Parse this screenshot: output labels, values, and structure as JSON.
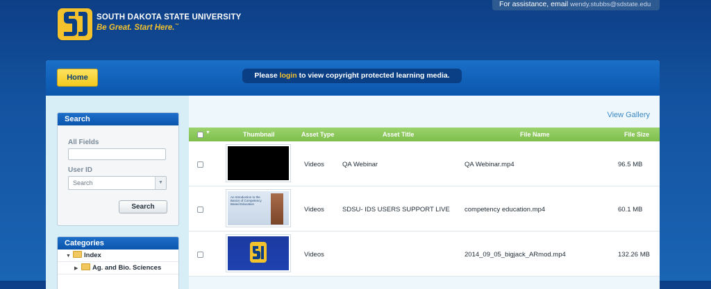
{
  "header": {
    "university_name": "SOUTH DAKOTA STATE UNIVERSITY",
    "tagline": "Be Great. Start Here.",
    "trademark": "™",
    "assistance_text": "For assistance, email",
    "assistance_email": "wendy.stubbs@sdstate.edu"
  },
  "topbar": {
    "home_label": "Home",
    "notice_before": "Please ",
    "notice_link": "login",
    "notice_after": " to view copyright protected learning media."
  },
  "search": {
    "title": "Search",
    "all_fields_label": "All Fields",
    "all_fields_value": "",
    "user_id_label": "User ID",
    "user_id_select_value": "Search",
    "button_label": "Search"
  },
  "categories": {
    "title": "Categories",
    "items": [
      {
        "label": "Index",
        "expanded": true
      },
      {
        "label": "Ag. and Bio. Sciences",
        "expanded": false
      }
    ]
  },
  "gallery": {
    "view_gallery_label": "View Gallery"
  },
  "table": {
    "headers": [
      "Thumbnail",
      "Asset Type",
      "Asset Title",
      "File Name",
      "File Size"
    ],
    "rows": [
      {
        "asset_type": "Videos",
        "asset_title": "QA Webinar",
        "file_name": "QA Webinar.mp4",
        "file_size": "96.5 MB",
        "thumb": "black"
      },
      {
        "asset_type": "Videos",
        "asset_title": "SDSU- IDS USERS SUPPORT LIVE",
        "file_name": "competency education.mp4",
        "file_size": "60.1 MB",
        "thumb": "lecture"
      },
      {
        "asset_type": "Videos",
        "asset_title": "",
        "file_name": "2014_09_05_bigjack_ARmod.mp4",
        "file_size": "132.26 MB",
        "thumb": "desktop"
      }
    ],
    "lecture_thumb_text": "An Introduction to the Basics of Competency Based Education"
  },
  "colors": {
    "brand_blue": "#0b56ad",
    "brand_yellow": "#f4c22c",
    "table_header_green": "#7dbe4b"
  }
}
